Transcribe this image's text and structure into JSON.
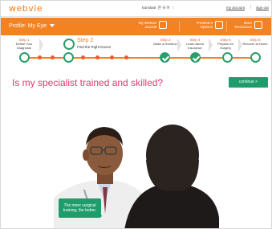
{
  "topbar": {
    "logo": "webvie",
    "translate": "translate: 한 국 어",
    "my_account": "my account",
    "sign_out": "sign out"
  },
  "header": {
    "profile_label": "Profile: My Eye",
    "journal_label": "My Webvie Journal",
    "treatment_label": "Treatment Options",
    "resources_label": "More Resources"
  },
  "steps": [
    {
      "num": "Step 1",
      "text": "Define Your Diagnosis",
      "done": false
    },
    {
      "num": "Step 2",
      "text": "Find the Right Doctor",
      "current": true
    },
    {
      "num": "Step 3",
      "text": "Make a Decision",
      "done": true
    },
    {
      "num": "Step 4",
      "text": "Learn About Insurance",
      "done": true
    },
    {
      "num": "Step 5",
      "text": "Prepare for Surgery",
      "done": false
    },
    {
      "num": "Step 6",
      "text": "Recover at Home",
      "done": false
    }
  ],
  "main": {
    "question": "Is my specialist trained and skilled?",
    "continue_label": "continue >",
    "caption": "The more surgical training, the better."
  },
  "colors": {
    "brand_orange": "#f58220",
    "accent_pink": "#e8366c",
    "accent_green": "#1f9c6c"
  }
}
